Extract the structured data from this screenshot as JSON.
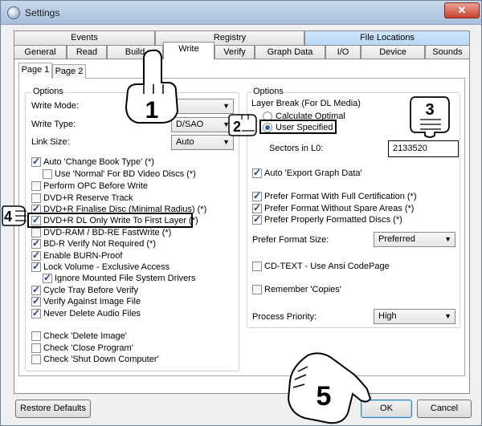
{
  "window": {
    "title": "Settings",
    "close_glyph": "✕"
  },
  "tabs_row1": [
    {
      "label": "Events"
    },
    {
      "label": "Registry"
    },
    {
      "label": "File Locations"
    }
  ],
  "tabs_row2": [
    {
      "label": "General"
    },
    {
      "label": "Read"
    },
    {
      "label": "Build"
    },
    {
      "label": "Write",
      "active": true
    },
    {
      "label": "Verify"
    },
    {
      "label": "Graph Data"
    },
    {
      "label": "I/O"
    },
    {
      "label": "Device"
    },
    {
      "label": "Sounds"
    }
  ],
  "subtabs": [
    {
      "label": "Page 1"
    },
    {
      "label": "Page 2"
    }
  ],
  "left_options": {
    "title": "Options",
    "write_mode": {
      "label": "Write Mode:",
      "value": ""
    },
    "write_type": {
      "label": "Write Type:",
      "value": "D/SAO"
    },
    "link_size": {
      "label": "Link Size:",
      "value": "Auto"
    },
    "checks": [
      {
        "label": "Auto 'Change Book Type' (*)",
        "checked": true
      },
      {
        "label": "Use 'Normal' For BD Video Discs (*)",
        "checked": false
      },
      {
        "label": "Perform OPC Before Write",
        "checked": false
      },
      {
        "label": "DVD+R Reserve Track",
        "checked": false
      },
      {
        "label": "DVD+R Finalise Disc (Minimal Radius) (*)",
        "checked": true
      },
      {
        "label": "DVD+R DL Only Write To First Layer (*)",
        "checked": true
      },
      {
        "label": "DVD-RAM / BD-RE FastWrite (*)",
        "checked": false
      },
      {
        "label": "BD-R Verify Not Required (*)",
        "checked": true
      },
      {
        "label": "Enable BURN-Proof",
        "checked": true
      },
      {
        "label": "Lock Volume - Exclusive Access",
        "checked": true
      },
      {
        "label": "Ignore Mounted File System Drivers",
        "checked": true
      },
      {
        "label": "Cycle Tray Before Verify",
        "checked": true
      },
      {
        "label": "Verify Against Image File",
        "checked": true
      },
      {
        "label": "Never Delete Audio Files",
        "checked": true
      },
      {
        "label": "Check 'Delete Image'",
        "checked": false
      },
      {
        "label": "Check 'Close Program'",
        "checked": false
      },
      {
        "label": "Check 'Shut Down Computer'",
        "checked": false
      }
    ]
  },
  "right_options": {
    "title": "Options",
    "layer_break": {
      "label": "Layer Break (For DL Media)",
      "calc_optimal": "Calculate Optimal",
      "user_specified": "User Specified",
      "selected": "user_specified"
    },
    "sectors": {
      "label": "Sectors in L0:",
      "value": "2133520"
    },
    "auto_export": {
      "label": "Auto 'Export Graph Data'",
      "checked": true
    },
    "prefer_checks": [
      {
        "label": "Prefer Format With Full Certification (*)",
        "checked": true
      },
      {
        "label": "Prefer Format Without Spare Areas (*)",
        "checked": true
      },
      {
        "label": "Prefer Properly Formatted Discs (*)",
        "checked": true
      }
    ],
    "prefer_format_size": {
      "label": "Prefer Format Size:",
      "value": "Preferred"
    },
    "cdtext": {
      "label": "CD-TEXT - Use Ansi CodePage",
      "checked": false
    },
    "remember_copies": {
      "label": "Remember 'Copies'",
      "checked": false
    },
    "process_priority": {
      "label": "Process Priority:",
      "value": "High"
    }
  },
  "buttons": {
    "restore": "Restore Defaults",
    "ok": "OK",
    "cancel": "Cancel"
  },
  "annotations": {
    "n1": "1",
    "n2": "2",
    "n3": "3",
    "n4": "4",
    "n5": "5"
  }
}
